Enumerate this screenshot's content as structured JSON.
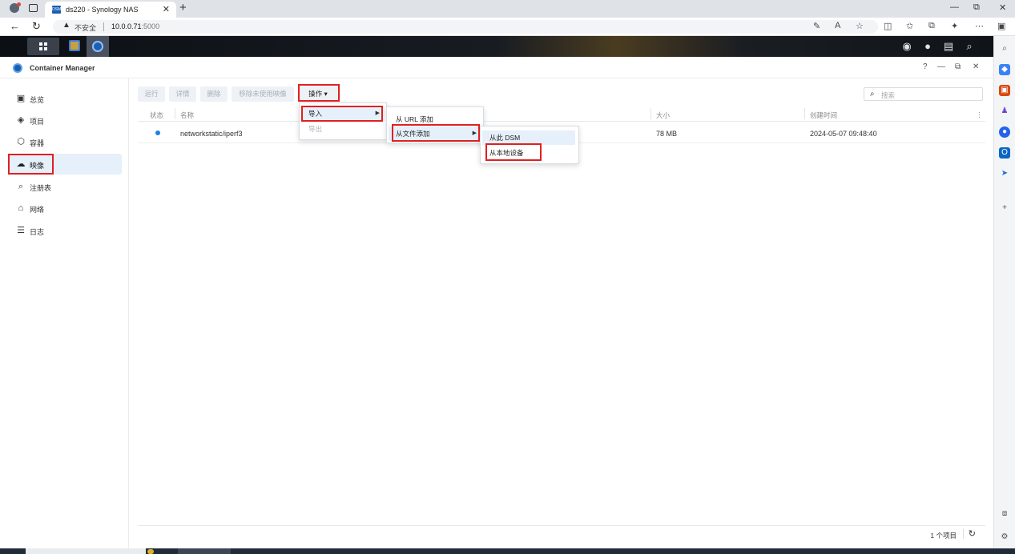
{
  "browser": {
    "tab_title": "ds220 - Synology NAS",
    "tab_favicon_text": "DSM",
    "insecure_label": "不安全",
    "url_host": "10.0.0.71",
    "url_port": ":5000"
  },
  "app": {
    "title": "Container Manager",
    "window_buttons": [
      "?",
      "—",
      "⧉",
      "✕"
    ]
  },
  "sidebar": {
    "items": [
      {
        "label": "总览",
        "icon": "overview-icon",
        "active": false
      },
      {
        "label": "项目",
        "icon": "project-icon",
        "active": false
      },
      {
        "label": "容器",
        "icon": "container-icon",
        "active": false
      },
      {
        "label": "映像",
        "icon": "image-icon",
        "active": true
      },
      {
        "label": "注册表",
        "icon": "registry-icon",
        "active": false
      },
      {
        "label": "网络",
        "icon": "network-icon",
        "active": false
      },
      {
        "label": "日志",
        "icon": "log-icon",
        "active": false
      }
    ]
  },
  "toolbar": {
    "run": "运行",
    "details": "详情",
    "delete": "删除",
    "remove_unused": "移除未使用映像",
    "actions": "操作 ▾"
  },
  "search": {
    "placeholder": "搜索"
  },
  "table": {
    "headers": [
      "状态",
      "名称",
      "大小",
      "创建时间"
    ],
    "rows": [
      {
        "name": "networkstatic/iperf3",
        "size": "78 MB",
        "created": "2024-05-07 09:48:40",
        "status_color": "#1e7fe0"
      }
    ]
  },
  "menu_actions": {
    "import": "导入",
    "export": "导出"
  },
  "menu_import": {
    "from_url": "从 URL 添加",
    "from_file": "从文件添加"
  },
  "menu_file": {
    "from_dsm": "从此 DSM",
    "from_local": "从本地设备"
  },
  "footer": {
    "count": "1 个项目"
  },
  "colors": {
    "accent": "#1e7fe0",
    "highlight_box": "#e02020",
    "active_bg": "#e6f0fb"
  }
}
